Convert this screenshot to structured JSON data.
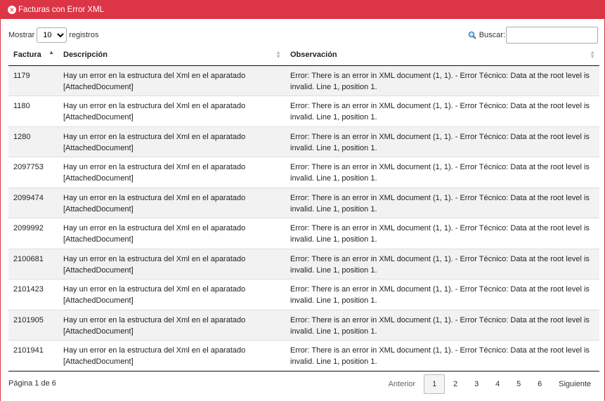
{
  "window": {
    "title": "Facturas con Error XML"
  },
  "controls": {
    "show_label": "Mostrar",
    "page_size": "10",
    "records_label": "registros",
    "search_label": "Buscar:",
    "search_value": ""
  },
  "table": {
    "columns": [
      "Factura",
      "Descripción",
      "Observación"
    ],
    "sorted_column": "Factura",
    "rows": [
      {
        "factura": "1179",
        "descripcion": "Hay un error en la estructura del Xml en el aparatado [AttachedDocument]",
        "observacion": "Error: There is an error in XML document (1, 1). - Error Técnico: Data at the root level is invalid. Line 1, position 1."
      },
      {
        "factura": "1180",
        "descripcion": "Hay un error en la estructura del Xml en el aparatado [AttachedDocument]",
        "observacion": "Error: There is an error in XML document (1, 1). - Error Técnico: Data at the root level is invalid. Line 1, position 1."
      },
      {
        "factura": "1280",
        "descripcion": "Hay un error en la estructura del Xml en el aparatado [AttachedDocument]",
        "observacion": "Error: There is an error in XML document (1, 1). - Error Técnico: Data at the root level is invalid. Line 1, position 1."
      },
      {
        "factura": "2097753",
        "descripcion": "Hay un error en la estructura del Xml en el aparatado [AttachedDocument]",
        "observacion": "Error: There is an error in XML document (1, 1). - Error Técnico: Data at the root level is invalid. Line 1, position 1."
      },
      {
        "factura": "2099474",
        "descripcion": "Hay un error en la estructura del Xml en el aparatado [AttachedDocument]",
        "observacion": "Error: There is an error in XML document (1, 1). - Error Técnico: Data at the root level is invalid. Line 1, position 1."
      },
      {
        "factura": "2099992",
        "descripcion": "Hay un error en la estructura del Xml en el aparatado [AttachedDocument]",
        "observacion": "Error: There is an error in XML document (1, 1). - Error Técnico: Data at the root level is invalid. Line 1, position 1."
      },
      {
        "factura": "2100681",
        "descripcion": "Hay un error en la estructura del Xml en el aparatado [AttachedDocument]",
        "observacion": "Error: There is an error in XML document (1, 1). - Error Técnico: Data at the root level is invalid. Line 1, position 1."
      },
      {
        "factura": "2101423",
        "descripcion": "Hay un error en la estructura del Xml en el aparatado [AttachedDocument]",
        "observacion": "Error: There is an error in XML document (1, 1). - Error Técnico: Data at the root level is invalid. Line 1, position 1."
      },
      {
        "factura": "2101905",
        "descripcion": "Hay un error en la estructura del Xml en el aparatado [AttachedDocument]",
        "observacion": "Error: There is an error in XML document (1, 1). - Error Técnico: Data at the root level is invalid. Line 1, position 1."
      },
      {
        "factura": "2101941",
        "descripcion": "Hay un error en la estructura del Xml en el aparatado [AttachedDocument]",
        "observacion": "Error: There is an error in XML document (1, 1). - Error Técnico: Data at the root level is invalid. Line 1, position 1."
      }
    ]
  },
  "footer": {
    "info": "Página 1 de 6",
    "prev_label": "Anterior",
    "pages": [
      "1",
      "2",
      "3",
      "4",
      "5",
      "6"
    ],
    "current_page": "1",
    "next_label": "Siguiente"
  },
  "colors": {
    "accent": "#dc3545"
  },
  "icons": {
    "close": "times-circle-icon",
    "search": "search-icon",
    "sort": "sort-icon"
  }
}
